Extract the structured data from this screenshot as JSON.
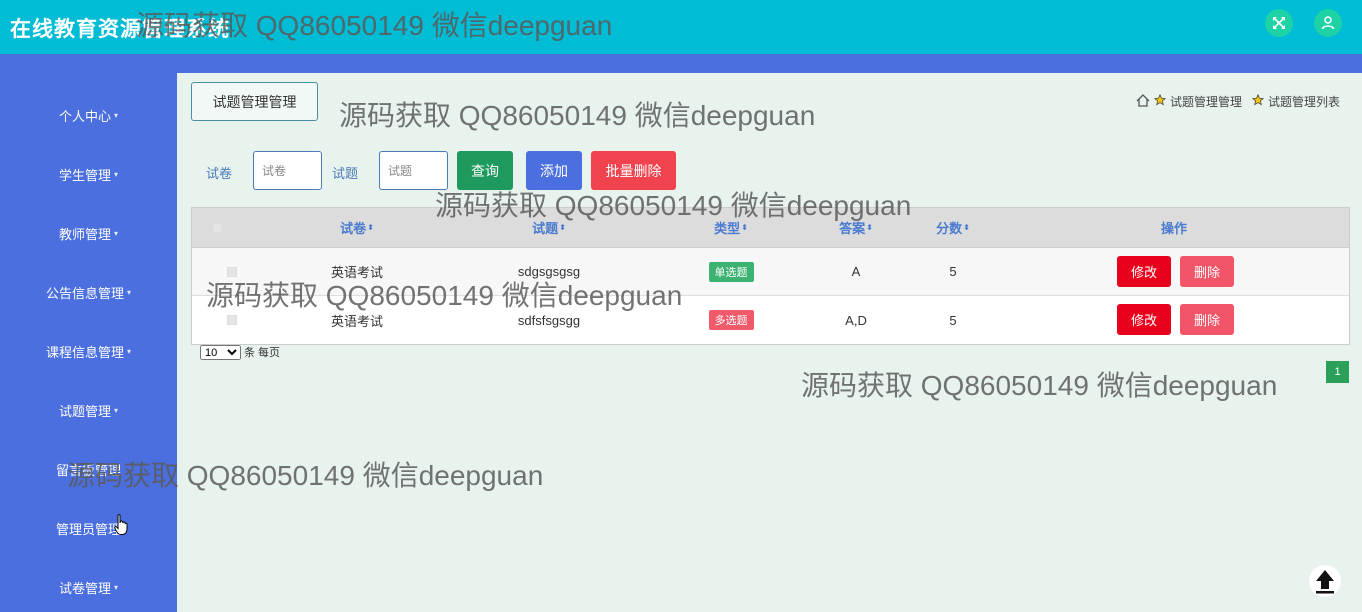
{
  "app": {
    "title": "在线教育资源管理系统"
  },
  "header_icons": [
    "fullscreen-icon",
    "user-icon"
  ],
  "sidebar": {
    "items": [
      {
        "label": "个人中心",
        "has_caret": true
      },
      {
        "label": "学生管理",
        "has_caret": true
      },
      {
        "label": "教师管理",
        "has_caret": true
      },
      {
        "label": "公告信息管理",
        "has_caret": true
      },
      {
        "label": "课程信息管理",
        "has_caret": true
      },
      {
        "label": "试题管理",
        "has_caret": true
      },
      {
        "label": "留言板管理",
        "has_caret": false
      },
      {
        "label": "管理员管理",
        "has_caret": false
      },
      {
        "label": "试卷管理",
        "has_caret": true
      }
    ],
    "caret": "▾"
  },
  "page": {
    "title": "试题管理管理",
    "breadcrumb": {
      "item1": "试题管理管理",
      "item2": "试题管理列表"
    }
  },
  "search": {
    "label1": "试卷",
    "placeholder1": "试卷",
    "label2": "试题",
    "placeholder2": "试题",
    "query_btn": "查询",
    "add_btn": "添加",
    "batch_delete_btn": "批量删除"
  },
  "table": {
    "headers": {
      "paper": "试卷",
      "question": "试题",
      "type": "类型",
      "answer": "答案",
      "score": "分数",
      "actions": "操作"
    },
    "sort_icon": "⬍",
    "rows": [
      {
        "paper": "英语考试",
        "question": "sdgsgsgsg",
        "type": "单选题",
        "type_color": "#3cb371",
        "answer": "A",
        "score": "5",
        "edit": "修改",
        "delete": "删除"
      },
      {
        "paper": "英语考试",
        "question": "sdfsfsgsgg",
        "type": "多选题",
        "type_color": "#f05a6a",
        "answer": "A,D",
        "score": "5",
        "edit": "修改",
        "delete": "删除"
      }
    ]
  },
  "pager": {
    "page_size": "10",
    "per_page_label": "条 每页",
    "current_page": "1"
  },
  "watermark": "源码获取 QQ86050149 微信deepguan",
  "colors": {
    "topbar": "#00bcd4",
    "sidebar": "#4b6fdf",
    "query": "#1e9a5e",
    "add": "#4b6fdf",
    "danger": "#f0434d",
    "edit": "#e8001c",
    "delete": "#f35568"
  }
}
